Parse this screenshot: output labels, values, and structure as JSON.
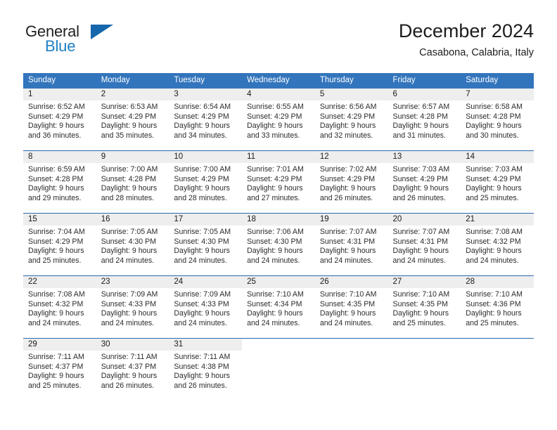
{
  "brand": {
    "name_part1": "General",
    "name_part2": "Blue",
    "triangle_color": "#1566ab",
    "blue_color": "#1f7fc4"
  },
  "header": {
    "title": "December 2024",
    "subtitle": "Casabona, Calabria, Italy"
  },
  "theme": {
    "header_bg": "#3375bc",
    "row_divider": "#2a6aad",
    "daynum_bg": "#eeeeee"
  },
  "weekday_headers": [
    "Sunday",
    "Monday",
    "Tuesday",
    "Wednesday",
    "Thursday",
    "Friday",
    "Saturday"
  ],
  "weeks": [
    [
      {
        "day": "1",
        "sunrise": "Sunrise: 6:52 AM",
        "sunset": "Sunset: 4:29 PM",
        "daylight_line1": "Daylight: 9 hours",
        "daylight_line2": "and 36 minutes."
      },
      {
        "day": "2",
        "sunrise": "Sunrise: 6:53 AM",
        "sunset": "Sunset: 4:29 PM",
        "daylight_line1": "Daylight: 9 hours",
        "daylight_line2": "and 35 minutes."
      },
      {
        "day": "3",
        "sunrise": "Sunrise: 6:54 AM",
        "sunset": "Sunset: 4:29 PM",
        "daylight_line1": "Daylight: 9 hours",
        "daylight_line2": "and 34 minutes."
      },
      {
        "day": "4",
        "sunrise": "Sunrise: 6:55 AM",
        "sunset": "Sunset: 4:29 PM",
        "daylight_line1": "Daylight: 9 hours",
        "daylight_line2": "and 33 minutes."
      },
      {
        "day": "5",
        "sunrise": "Sunrise: 6:56 AM",
        "sunset": "Sunset: 4:29 PM",
        "daylight_line1": "Daylight: 9 hours",
        "daylight_line2": "and 32 minutes."
      },
      {
        "day": "6",
        "sunrise": "Sunrise: 6:57 AM",
        "sunset": "Sunset: 4:28 PM",
        "daylight_line1": "Daylight: 9 hours",
        "daylight_line2": "and 31 minutes."
      },
      {
        "day": "7",
        "sunrise": "Sunrise: 6:58 AM",
        "sunset": "Sunset: 4:28 PM",
        "daylight_line1": "Daylight: 9 hours",
        "daylight_line2": "and 30 minutes."
      }
    ],
    [
      {
        "day": "8",
        "sunrise": "Sunrise: 6:59 AM",
        "sunset": "Sunset: 4:28 PM",
        "daylight_line1": "Daylight: 9 hours",
        "daylight_line2": "and 29 minutes."
      },
      {
        "day": "9",
        "sunrise": "Sunrise: 7:00 AM",
        "sunset": "Sunset: 4:28 PM",
        "daylight_line1": "Daylight: 9 hours",
        "daylight_line2": "and 28 minutes."
      },
      {
        "day": "10",
        "sunrise": "Sunrise: 7:00 AM",
        "sunset": "Sunset: 4:29 PM",
        "daylight_line1": "Daylight: 9 hours",
        "daylight_line2": "and 28 minutes."
      },
      {
        "day": "11",
        "sunrise": "Sunrise: 7:01 AM",
        "sunset": "Sunset: 4:29 PM",
        "daylight_line1": "Daylight: 9 hours",
        "daylight_line2": "and 27 minutes."
      },
      {
        "day": "12",
        "sunrise": "Sunrise: 7:02 AM",
        "sunset": "Sunset: 4:29 PM",
        "daylight_line1": "Daylight: 9 hours",
        "daylight_line2": "and 26 minutes."
      },
      {
        "day": "13",
        "sunrise": "Sunrise: 7:03 AM",
        "sunset": "Sunset: 4:29 PM",
        "daylight_line1": "Daylight: 9 hours",
        "daylight_line2": "and 26 minutes."
      },
      {
        "day": "14",
        "sunrise": "Sunrise: 7:03 AM",
        "sunset": "Sunset: 4:29 PM",
        "daylight_line1": "Daylight: 9 hours",
        "daylight_line2": "and 25 minutes."
      }
    ],
    [
      {
        "day": "15",
        "sunrise": "Sunrise: 7:04 AM",
        "sunset": "Sunset: 4:29 PM",
        "daylight_line1": "Daylight: 9 hours",
        "daylight_line2": "and 25 minutes."
      },
      {
        "day": "16",
        "sunrise": "Sunrise: 7:05 AM",
        "sunset": "Sunset: 4:30 PM",
        "daylight_line1": "Daylight: 9 hours",
        "daylight_line2": "and 24 minutes."
      },
      {
        "day": "17",
        "sunrise": "Sunrise: 7:05 AM",
        "sunset": "Sunset: 4:30 PM",
        "daylight_line1": "Daylight: 9 hours",
        "daylight_line2": "and 24 minutes."
      },
      {
        "day": "18",
        "sunrise": "Sunrise: 7:06 AM",
        "sunset": "Sunset: 4:30 PM",
        "daylight_line1": "Daylight: 9 hours",
        "daylight_line2": "and 24 minutes."
      },
      {
        "day": "19",
        "sunrise": "Sunrise: 7:07 AM",
        "sunset": "Sunset: 4:31 PM",
        "daylight_line1": "Daylight: 9 hours",
        "daylight_line2": "and 24 minutes."
      },
      {
        "day": "20",
        "sunrise": "Sunrise: 7:07 AM",
        "sunset": "Sunset: 4:31 PM",
        "daylight_line1": "Daylight: 9 hours",
        "daylight_line2": "and 24 minutes."
      },
      {
        "day": "21",
        "sunrise": "Sunrise: 7:08 AM",
        "sunset": "Sunset: 4:32 PM",
        "daylight_line1": "Daylight: 9 hours",
        "daylight_line2": "and 24 minutes."
      }
    ],
    [
      {
        "day": "22",
        "sunrise": "Sunrise: 7:08 AM",
        "sunset": "Sunset: 4:32 PM",
        "daylight_line1": "Daylight: 9 hours",
        "daylight_line2": "and 24 minutes."
      },
      {
        "day": "23",
        "sunrise": "Sunrise: 7:09 AM",
        "sunset": "Sunset: 4:33 PM",
        "daylight_line1": "Daylight: 9 hours",
        "daylight_line2": "and 24 minutes."
      },
      {
        "day": "24",
        "sunrise": "Sunrise: 7:09 AM",
        "sunset": "Sunset: 4:33 PM",
        "daylight_line1": "Daylight: 9 hours",
        "daylight_line2": "and 24 minutes."
      },
      {
        "day": "25",
        "sunrise": "Sunrise: 7:10 AM",
        "sunset": "Sunset: 4:34 PM",
        "daylight_line1": "Daylight: 9 hours",
        "daylight_line2": "and 24 minutes."
      },
      {
        "day": "26",
        "sunrise": "Sunrise: 7:10 AM",
        "sunset": "Sunset: 4:35 PM",
        "daylight_line1": "Daylight: 9 hours",
        "daylight_line2": "and 24 minutes."
      },
      {
        "day": "27",
        "sunrise": "Sunrise: 7:10 AM",
        "sunset": "Sunset: 4:35 PM",
        "daylight_line1": "Daylight: 9 hours",
        "daylight_line2": "and 25 minutes."
      },
      {
        "day": "28",
        "sunrise": "Sunrise: 7:10 AM",
        "sunset": "Sunset: 4:36 PM",
        "daylight_line1": "Daylight: 9 hours",
        "daylight_line2": "and 25 minutes."
      }
    ],
    [
      {
        "day": "29",
        "sunrise": "Sunrise: 7:11 AM",
        "sunset": "Sunset: 4:37 PM",
        "daylight_line1": "Daylight: 9 hours",
        "daylight_line2": "and 25 minutes."
      },
      {
        "day": "30",
        "sunrise": "Sunrise: 7:11 AM",
        "sunset": "Sunset: 4:37 PM",
        "daylight_line1": "Daylight: 9 hours",
        "daylight_line2": "and 26 minutes."
      },
      {
        "day": "31",
        "sunrise": "Sunrise: 7:11 AM",
        "sunset": "Sunset: 4:38 PM",
        "daylight_line1": "Daylight: 9 hours",
        "daylight_line2": "and 26 minutes."
      },
      {
        "day": "",
        "sunrise": "",
        "sunset": "",
        "daylight_line1": "",
        "daylight_line2": ""
      },
      {
        "day": "",
        "sunrise": "",
        "sunset": "",
        "daylight_line1": "",
        "daylight_line2": ""
      },
      {
        "day": "",
        "sunrise": "",
        "sunset": "",
        "daylight_line1": "",
        "daylight_line2": ""
      },
      {
        "day": "",
        "sunrise": "",
        "sunset": "",
        "daylight_line1": "",
        "daylight_line2": ""
      }
    ]
  ]
}
